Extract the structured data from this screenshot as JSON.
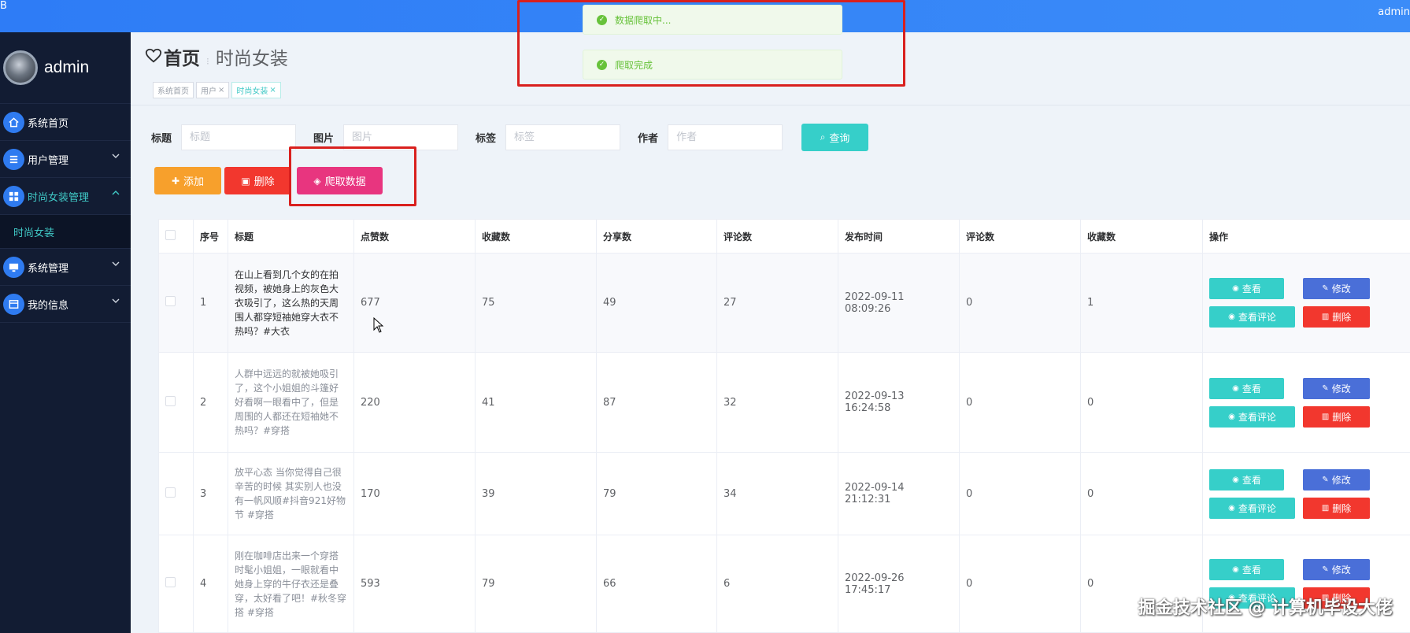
{
  "topbar": {
    "corner": "B",
    "user": "admin"
  },
  "sidebar": {
    "username": "admin",
    "items": [
      {
        "label": "系统首页"
      },
      {
        "label": "用户管理"
      },
      {
        "label": "时尚女装管理"
      },
      {
        "label": "系统管理"
      },
      {
        "label": "我的信息"
      }
    ],
    "submenu": "时尚女装"
  },
  "breadcrumb": {
    "home": "首页",
    "current": "时尚女装"
  },
  "tags": [
    {
      "label": "系统首页"
    },
    {
      "label": "用户",
      "close": "×"
    },
    {
      "label": "时尚女装",
      "close": "×"
    }
  ],
  "notifications": [
    "数据爬取中...",
    "爬取完成"
  ],
  "search": {
    "title_label": "标题",
    "title_placeholder": "标题",
    "image_label": "图片",
    "image_placeholder": "图片",
    "tag_label": "标签",
    "tag_placeholder": "标签",
    "author_label": "作者",
    "author_placeholder": "作者",
    "query_button": "查询"
  },
  "actions": {
    "add": "添加",
    "delete": "删除",
    "crawl": "爬取数据"
  },
  "table": {
    "headers": [
      "序号",
      "标题",
      "点赞数",
      "收藏数",
      "分享数",
      "评论数",
      "发布时间",
      "评论数",
      "收藏数",
      "操作"
    ],
    "rows": [
      {
        "index": "1",
        "title": "在山上看到几个女的在拍视频，被她身上的灰色大衣吸引了，这么热的天周围人都穿短袖她穿大衣不热吗？#大衣",
        "likes": "677",
        "favorites": "75",
        "shares": "49",
        "comments": "27",
        "time": "2022-09-11 08:09:26",
        "comments2": "0",
        "favorites2": "1"
      },
      {
        "index": "2",
        "title": "人群中远远的就被她吸引了，这个小姐姐的斗篷好好看啊一眼看中了，但是周围的人都还在短袖她不热吗？#穿搭",
        "likes": "220",
        "favorites": "41",
        "shares": "87",
        "comments": "32",
        "time": "2022-09-13 16:24:58",
        "comments2": "0",
        "favorites2": "0"
      },
      {
        "index": "3",
        "title": "放平心态 当你觉得自己很辛苦的时候 其实别人也没有一帆风顺#抖音921好物节 #穿搭",
        "likes": "170",
        "favorites": "39",
        "shares": "79",
        "comments": "34",
        "time": "2022-09-14 21:12:31",
        "comments2": "0",
        "favorites2": "0"
      },
      {
        "index": "4",
        "title": "刚在咖啡店出来一个穿搭时髦小姐姐，一眼就看中她身上穿的牛仔衣还是叠穿，太好看了吧！#秋冬穿搭 #穿搭",
        "likes": "593",
        "favorites": "79",
        "shares": "66",
        "comments": "6",
        "time": "2022-09-26 17:45:17",
        "comments2": "0",
        "favorites2": "0"
      }
    ],
    "ops": {
      "view": "查看",
      "edit": "修改",
      "view_comments": "查看评论",
      "delete": "删除"
    }
  },
  "watermark": "掘金技术社区 @ 计算机毕设大佬",
  "colors": {
    "sidebar": "#121c33",
    "accent": "#36cfc9",
    "primary": "#2e7cf6",
    "danger": "#f2372e",
    "warning": "#f7a02c",
    "crawl": "#e8357f"
  }
}
